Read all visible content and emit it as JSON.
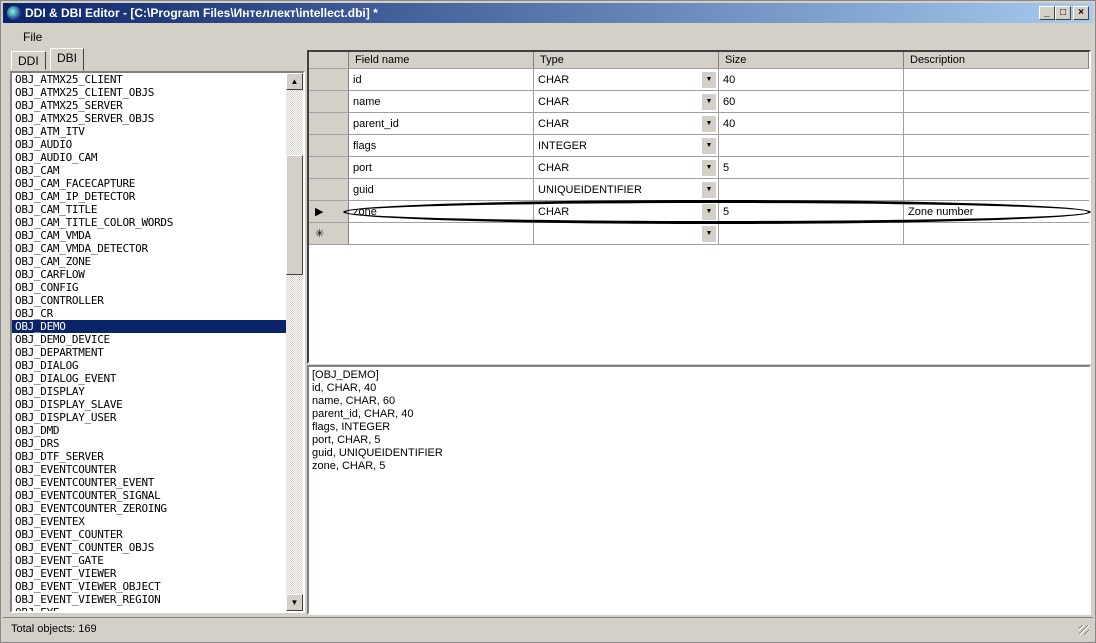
{
  "window": {
    "title": "DDI & DBI Editor - [C:\\Program Files\\Интеллект\\intellect.dbi] *",
    "min": "_",
    "max": "□",
    "close": "×"
  },
  "menu": {
    "file": "File"
  },
  "tabs": [
    {
      "label": "DDI"
    },
    {
      "label": "DBI"
    }
  ],
  "objects": [
    "OBJ_ATMX25_CLIENT",
    "OBJ_ATMX25_CLIENT_OBJS",
    "OBJ_ATMX25_SERVER",
    "OBJ_ATMX25_SERVER_OBJS",
    "OBJ_ATM_ITV",
    "OBJ_AUDIO",
    "OBJ_AUDIO_CAM",
    "OBJ_CAM",
    "OBJ_CAM_FACECAPTURE",
    "OBJ_CAM_IP_DETECTOR",
    "OBJ_CAM_TITLE",
    "OBJ_CAM_TITLE_COLOR_WORDS",
    "OBJ_CAM_VMDA",
    "OBJ_CAM_VMDA_DETECTOR",
    "OBJ_CAM_ZONE",
    "OBJ_CARFLOW",
    "OBJ_CONFIG",
    "OBJ_CONTROLLER",
    "OBJ_CR",
    "OBJ_DEMO",
    "OBJ_DEMO_DEVICE",
    "OBJ_DEPARTMENT",
    "OBJ_DIALOG",
    "OBJ_DIALOG_EVENT",
    "OBJ_DISPLAY",
    "OBJ_DISPLAY_SLAVE",
    "OBJ_DISPLAY_USER",
    "OBJ_DMD",
    "OBJ_DRS",
    "OBJ_DTF_SERVER",
    "OBJ_EVENTCOUNTER",
    "OBJ_EVENTCOUNTER_EVENT",
    "OBJ_EVENTCOUNTER_SIGNAL",
    "OBJ_EVENTCOUNTER_ZEROING",
    "OBJ_EVENTEX",
    "OBJ_EVENT_COUNTER",
    "OBJ_EVENT_COUNTER_OBJS",
    "OBJ_EVENT_GATE",
    "OBJ_EVENT_VIEWER",
    "OBJ_EVENT_VIEWER_OBJECT",
    "OBJ_EVENT_VIEWER_REGION",
    "OBJ_EYE"
  ],
  "selected_object": "OBJ_DEMO",
  "grid": {
    "headers": [
      "Field name",
      "Type",
      "Size",
      "Description"
    ],
    "rows": [
      {
        "field": "id",
        "type": "CHAR",
        "size": "40",
        "desc": ""
      },
      {
        "field": "name",
        "type": "CHAR",
        "size": "60",
        "desc": ""
      },
      {
        "field": "parent_id",
        "type": "CHAR",
        "size": "40",
        "desc": ""
      },
      {
        "field": "flags",
        "type": "INTEGER",
        "size": "",
        "desc": ""
      },
      {
        "field": "port",
        "type": "CHAR",
        "size": "5",
        "desc": ""
      },
      {
        "field": "guid",
        "type": "UNIQUEIDENTIFIER",
        "size": "",
        "desc": ""
      },
      {
        "field": "zone",
        "type": "CHAR",
        "size": "5",
        "desc": "Zone number",
        "current": true
      }
    ],
    "current_marker": "▶",
    "new_marker": "✳"
  },
  "preview_lines": [
    "[OBJ_DEMO]",
    "id, CHAR, 40",
    "name, CHAR, 60",
    "parent_id, CHAR, 40",
    "flags, INTEGER",
    "port, CHAR, 5",
    "guid, UNIQUEIDENTIFIER",
    "zone, CHAR, 5"
  ],
  "status": {
    "text": "Total objects: 169"
  }
}
